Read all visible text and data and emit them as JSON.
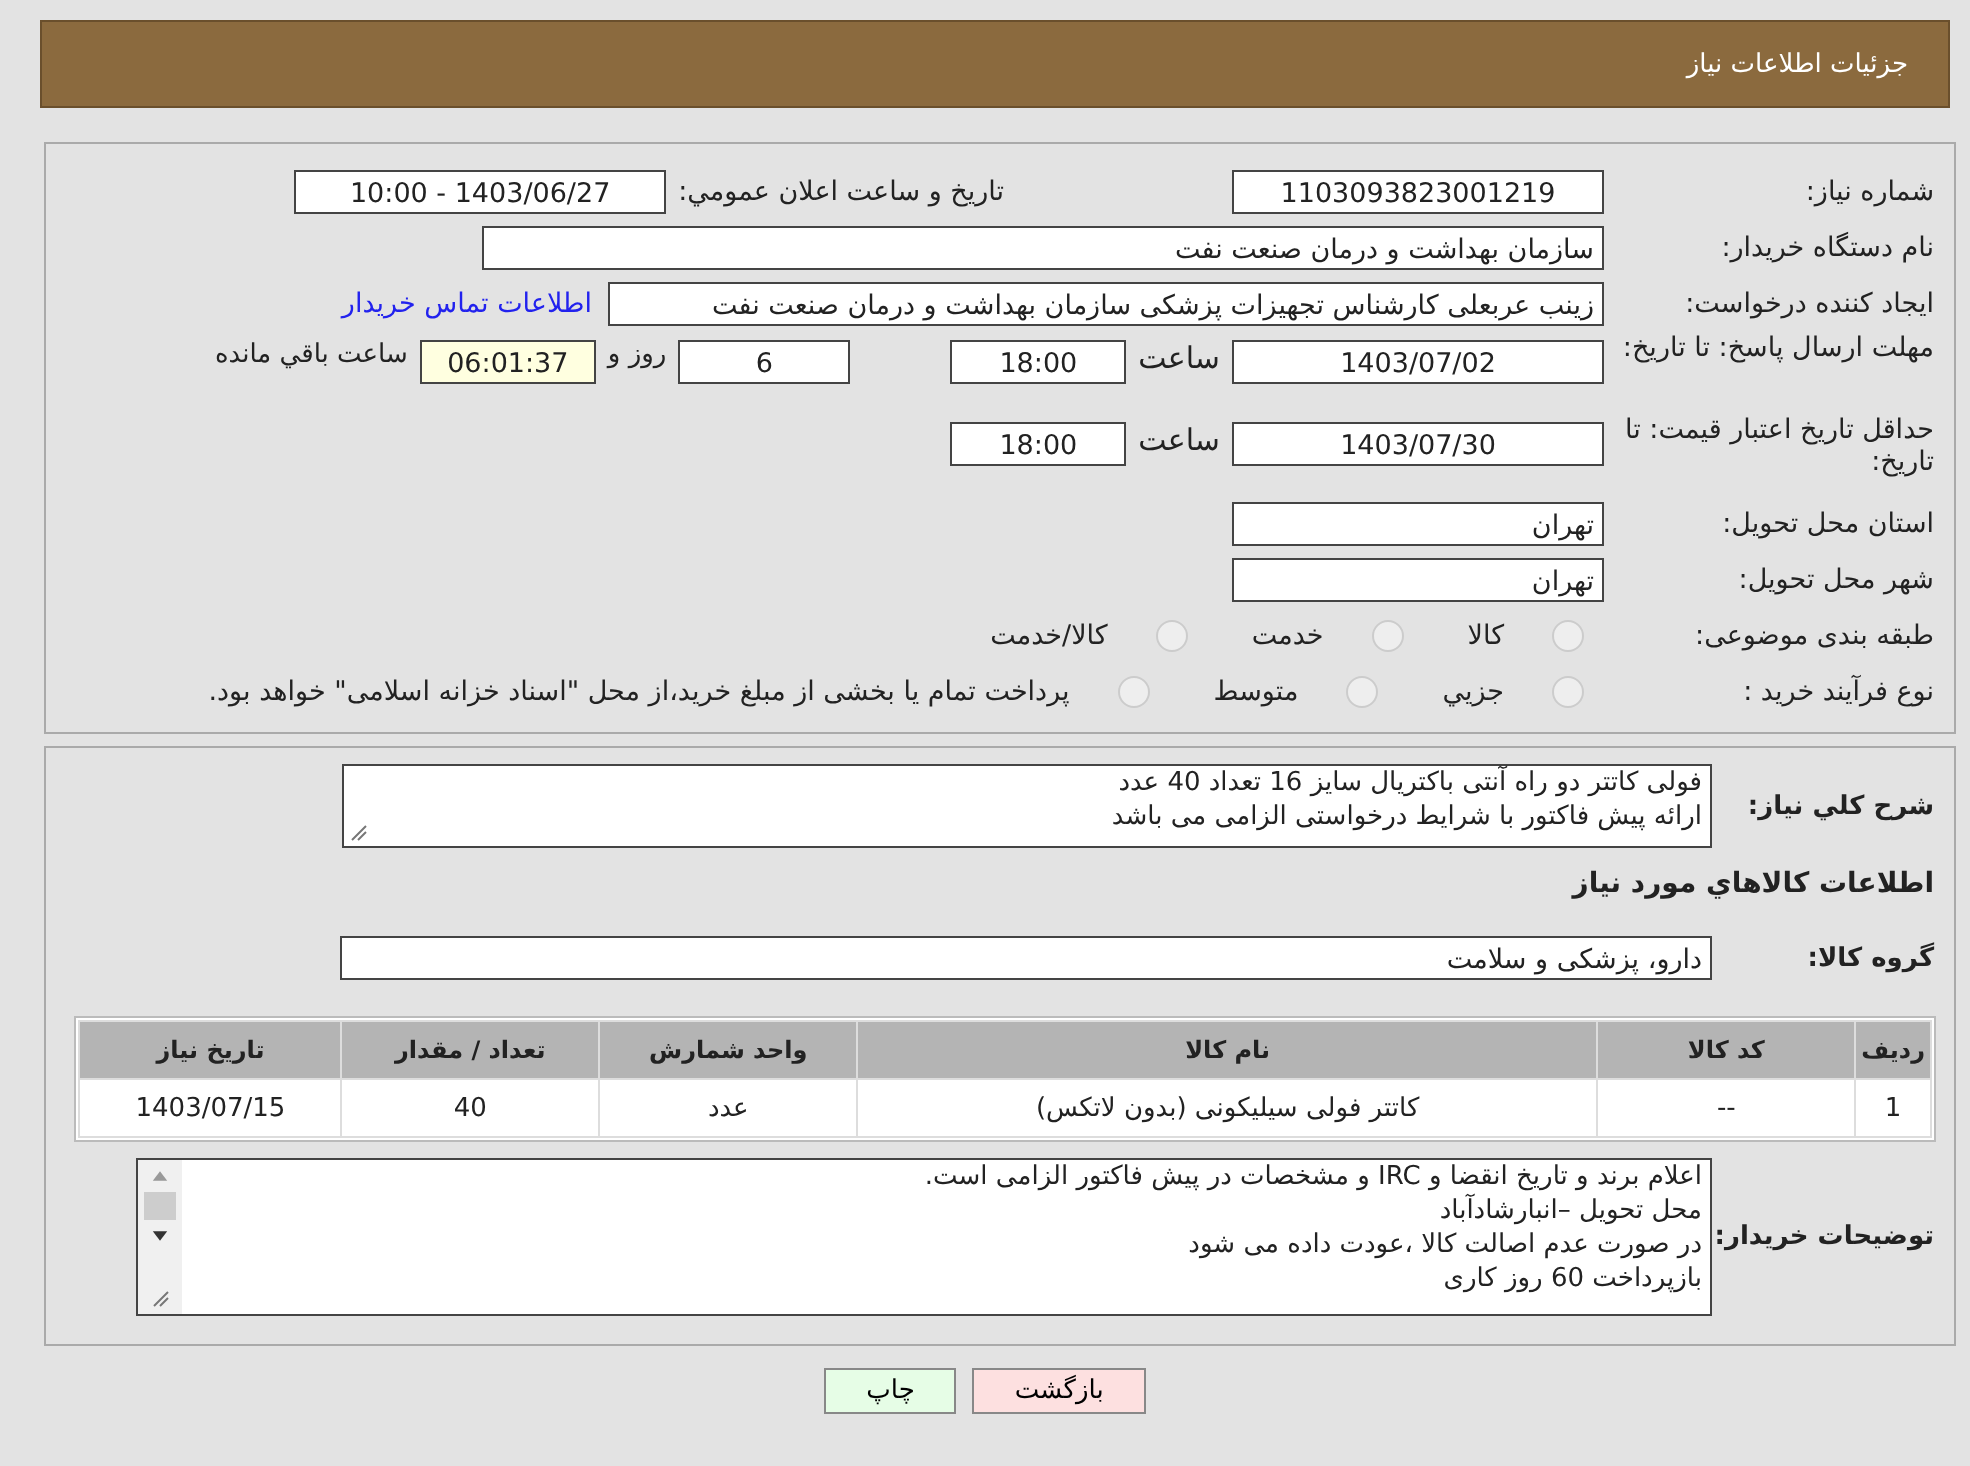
{
  "header": {
    "title": "جزئیات اطلاعات نیاز"
  },
  "need_number": {
    "label": "شماره نیاز:",
    "value": "1103093823001219"
  },
  "announce": {
    "label": "تاریخ و ساعت اعلان عمومي:",
    "value": "1403/06/27 - 10:00"
  },
  "buyer_org": {
    "label": "نام دستگاه خریدار:",
    "value": "سازمان بهداشت و درمان صنعت نفت"
  },
  "requester": {
    "label": "ایجاد کننده درخواست:",
    "value": "زینب عربعلی کارشناس تجهیزات پزشکی سازمان بهداشت و درمان صنعت نفت",
    "link": "اطلاعات تماس خریدار"
  },
  "response_deadline": {
    "label": "مهلت ارسال پاسخ: تا تاریخ:",
    "date": "1403/07/02",
    "time_label": "ساعت",
    "time": "18:00",
    "days": "6",
    "days_label": "روز و",
    "remaining": "06:01:37",
    "remaining_label": "ساعت باقي مانده"
  },
  "price_validity": {
    "label": "حداقل تاریخ اعتبار قیمت: تا تاریخ:",
    "date": "1403/07/30",
    "time_label": "ساعت",
    "time": "18:00"
  },
  "province": {
    "label": "استان محل تحویل:",
    "value": "تهران"
  },
  "city": {
    "label": "شهر محل تحویل:",
    "value": "تهران"
  },
  "category": {
    "label": "طبقه بندی موضوعی:",
    "options": [
      {
        "label": "کالا",
        "selected": false
      },
      {
        "label": "خدمت",
        "selected": false
      },
      {
        "label": "کالا/خدمت",
        "selected": false
      }
    ]
  },
  "purchase_type": {
    "label": "نوع فرآیند خرید :",
    "options": [
      {
        "label": "جزيي",
        "selected": false
      },
      {
        "label": "متوسط",
        "selected": false
      },
      {
        "label": "پرداخت تمام یا بخشی از مبلغ خرید،از محل \"اسناد خزانه اسلامی\" خواهد بود.",
        "selected": false
      }
    ]
  },
  "description": {
    "label": "شرح کلي نیاز:",
    "value": "فولی کاتتر دو راه آنتی باکتریال  سایز 16 تعداد 40 عدد\nارائه پیش فاکتور با شرایط درخواستی الزامی می باشد"
  },
  "goods_heading": "اطلاعات کالاهاي مورد نیاز",
  "goods_group": {
    "label": "گروه کالا:",
    "value": "دارو، پزشکی و سلامت"
  },
  "table": {
    "columns": [
      "ردیف",
      "کد کالا",
      "نام کالا",
      "واحد شمارش",
      "تعداد / مقدار",
      "تاریخ نیاز"
    ],
    "rows": [
      [
        "1",
        "--",
        "کاتتر فولی سیلیکونی (بدون لاتکس)",
        "عدد",
        "40",
        "1403/07/15"
      ]
    ]
  },
  "buyer_notes": {
    "label": "توضیحات خریدار:",
    "value": "اعلام برند و تاریخ انقضا  و IRC  و مشخصات  در پیش فاکتور الزامی است.\nمحل تحویل –انبارشادآباد\nدر صورت عدم اصالت کالا ،عودت داده می شود\nبازپرداخت 60 روز کاری"
  },
  "buttons": [
    {
      "label": "بازگشت",
      "kind": "back"
    },
    {
      "label": "چاپ",
      "kind": "print"
    }
  ]
}
